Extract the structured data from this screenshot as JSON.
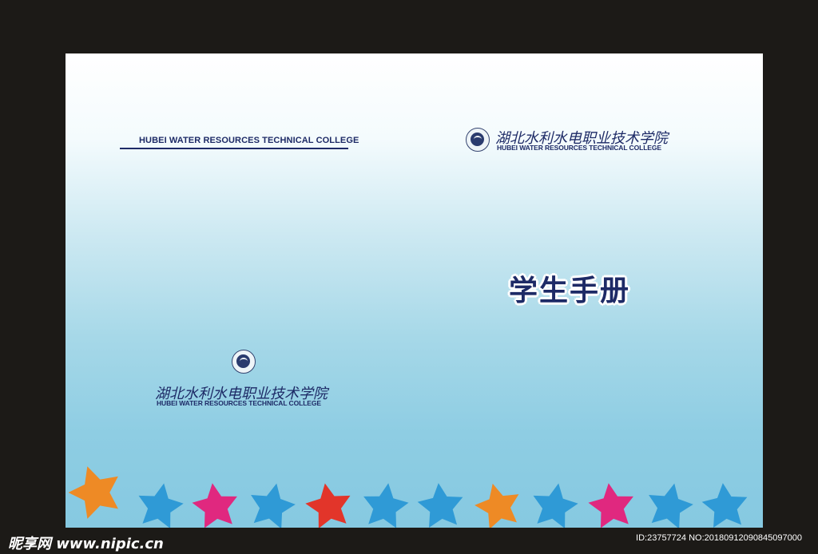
{
  "cover": {
    "header_text": "HUBEI WATER RESOURCES TECHNICAL COLLEGE",
    "college_cn": "湖北水利水电职业技术学院",
    "college_en": "HUBEI WATER RESOURCES TECHNICAL COLLEGE",
    "title": "学生手册"
  },
  "footer": {
    "watermark": "昵享网 www.nipic.cn",
    "id_text": "ID:23757724 NO:20180912090845097000"
  },
  "colors": {
    "frame": "#1c1a17",
    "navy": "#1d2a66",
    "star_orange": "#ee8a25",
    "star_blue": "#2f9ad6",
    "star_pink": "#e0287f",
    "star_red": "#e2352a"
  }
}
